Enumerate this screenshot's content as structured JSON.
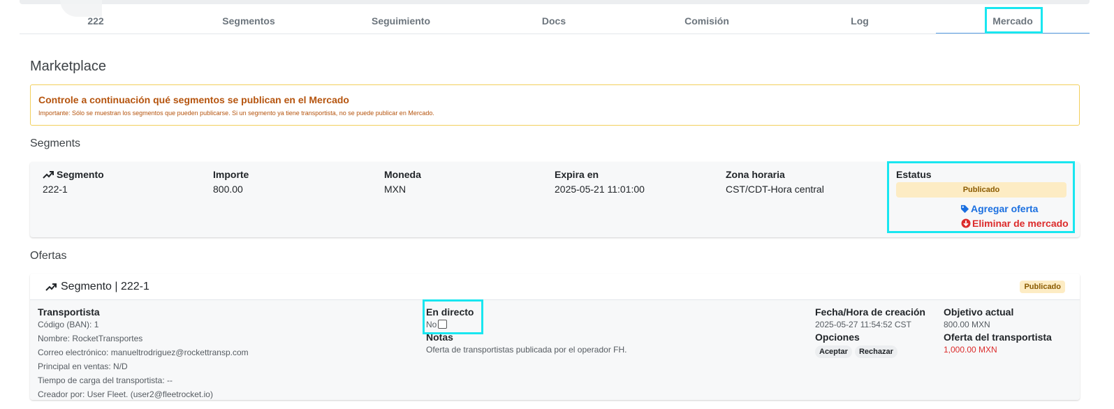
{
  "tabs": [
    {
      "label": "222"
    },
    {
      "label": "Segmentos"
    },
    {
      "label": "Seguimiento"
    },
    {
      "label": "Docs"
    },
    {
      "label": "Comisión"
    },
    {
      "label": "Log"
    },
    {
      "label": "Mercado",
      "active": true
    }
  ],
  "page_title": "Marketplace",
  "alert": {
    "title": "Controle a continuación qué segmentos se publican en el Mercado",
    "note": "Importante: Sólo se muestran los segmentos que pueden publicarse. Si un segmento ya tiene transportista, no se puede publicar en Mercado."
  },
  "segments_label": "Segments",
  "segment": {
    "headers": {
      "segment": "Segmento",
      "amount": "Importe",
      "currency": "Moneda",
      "expires": "Expira en",
      "timezone": "Zona horaria",
      "status": "Estatus"
    },
    "values": {
      "segment": "222-1",
      "amount": "800.00",
      "currency": "MXN",
      "expires": "2025-05-21 11:01:00",
      "timezone": "CST/CDT-Hora central",
      "status": "Publicado"
    },
    "add_offer": "Agregar oferta",
    "remove_market": "Eliminar de mercado"
  },
  "offers_label": "Ofertas",
  "offer": {
    "title": "Segmento | 222-1",
    "badge": "Publicado",
    "carrier": {
      "heading": "Transportista",
      "code": "Código (BAN): 1",
      "name": "Nombre: RocketTransportes",
      "email": "Correo electrónico: manueltrodriguez@rockettransp.com",
      "sales": "Principal en ventas: N/D",
      "load_time": "Tiempo de carga del transportista: --",
      "creator": "Creador por: User Fleet. (user2@fleetrocket.io)"
    },
    "live": {
      "heading": "En directo",
      "value": "No"
    },
    "notes": {
      "heading": "Notas",
      "text": "Oferta de transportistas publicada por el operador FH."
    },
    "created": {
      "heading": "Fecha/Hora de creación",
      "value": "2025-05-27 11:54:52 CST"
    },
    "options": {
      "heading": "Opciones",
      "accept": "Aceptar",
      "reject": "Rechazar"
    },
    "target": {
      "heading": "Objetivo actual",
      "value": "800.00 MXN"
    },
    "carrier_offer": {
      "heading": "Oferta del transportista",
      "value": "1,000.00 MXN"
    }
  },
  "colors": {
    "highlight": "#19e6f0",
    "alert_text": "#b5540e",
    "link_blue": "#1a6fe0",
    "danger": "#dc2b2b",
    "badge_bg": "#fdecc4"
  },
  "icons": [
    "trending-up-icon",
    "tag-icon",
    "remove-circle-icon"
  ]
}
